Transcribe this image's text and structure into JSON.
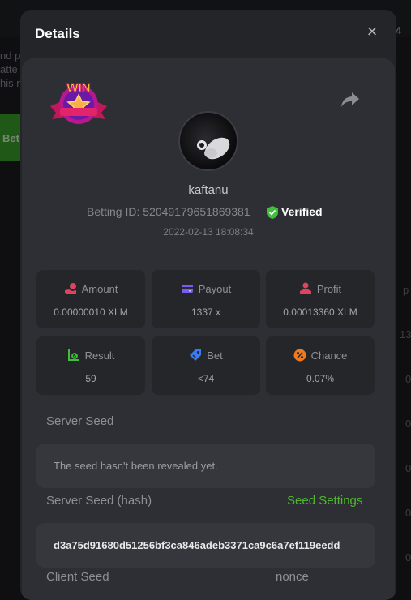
{
  "modal": {
    "title": "Details",
    "close": "×"
  },
  "header": {
    "badge_text": "WIN",
    "username": "kaftanu",
    "betting_id": "Betting ID: 52049179651869381",
    "verified_label": "Verified",
    "date": "2022-02-13 18:08:34"
  },
  "stats": {
    "amount": {
      "label": "Amount",
      "value": "0.00000010 XLM"
    },
    "payout": {
      "label": "Payout",
      "value": "1337 x"
    },
    "profit": {
      "label": "Profit",
      "value": "0.00013360 XLM"
    },
    "result": {
      "label": "Result",
      "value": "59"
    },
    "bet": {
      "label": "Bet",
      "value": "<74"
    },
    "chance": {
      "label": "Chance",
      "value": "0.07%"
    }
  },
  "seeds": {
    "server_seed_label": "Server Seed",
    "server_seed_value": "The seed hasn't been revealed yet.",
    "server_hash_label": "Server Seed (hash)",
    "seed_settings_label": "Seed Settings",
    "server_hash_value": "d3a75d91680d51256bf3ca846adeb3371ca9c6a7ef119eedd",
    "client_seed_label": "Client Seed",
    "nonce_label": "nonce"
  },
  "colors": {
    "accent_green": "#4fb72d",
    "amount_icon": "#e0435f",
    "payout_icon": "#7b5cf0",
    "profit_icon": "#e0435f",
    "result_icon": "#3fbf3a",
    "bet_icon": "#3a7bf0",
    "chance_icon": "#f07a1f"
  },
  "icons": {
    "amount": "hand-coin-icon",
    "payout": "card-icon",
    "profit": "profit-hand-icon",
    "result": "result-chart-icon",
    "bet": "ticket-icon",
    "chance": "percent-icon",
    "share": "share-icon",
    "verified": "verified-shield-icon",
    "close": "close-icon"
  }
}
